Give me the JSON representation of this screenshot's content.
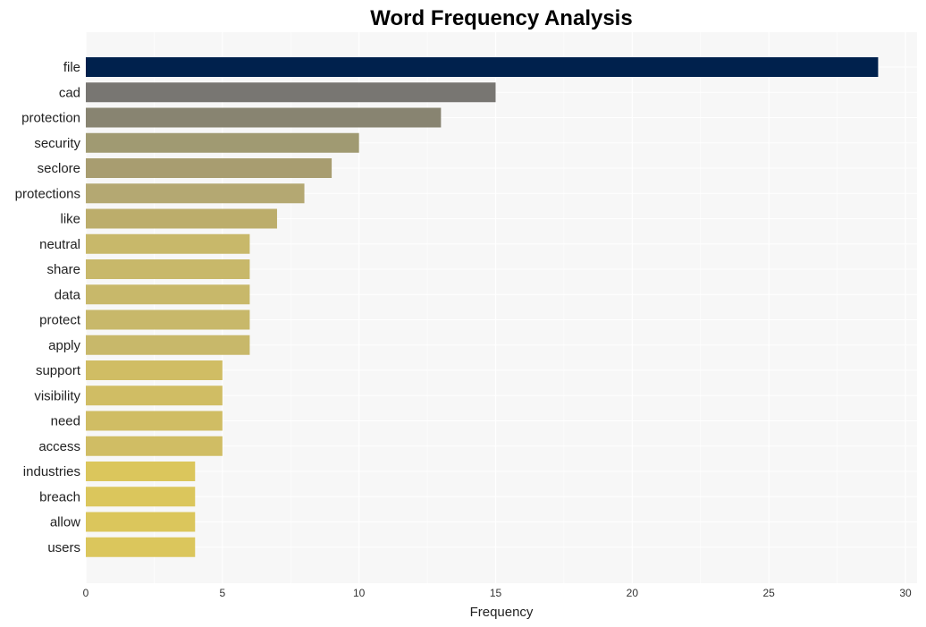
{
  "chart_data": {
    "type": "bar",
    "orientation": "horizontal",
    "title": "Word Frequency Analysis",
    "xlabel": "Frequency",
    "ylabel": "",
    "xlim": [
      0,
      30
    ],
    "xticks": [
      0,
      5,
      10,
      15,
      20,
      25,
      30
    ],
    "grid": true,
    "legend": "none",
    "categories": [
      "file",
      "cad",
      "protection",
      "security",
      "seclore",
      "protections",
      "like",
      "neutral",
      "share",
      "data",
      "protect",
      "apply",
      "support",
      "visibility",
      "need",
      "access",
      "industries",
      "breach",
      "allow",
      "users"
    ],
    "values": [
      29,
      15,
      13,
      10,
      9,
      8,
      7,
      6,
      6,
      6,
      6,
      6,
      5,
      5,
      5,
      5,
      4,
      4,
      4,
      4
    ],
    "colors": [
      "#00214d",
      "#787672",
      "#888471",
      "#a09a72",
      "#a89d70",
      "#b4a872",
      "#bcad6b",
      "#c8b86a",
      "#c8b86a",
      "#c8b86a",
      "#c8b86a",
      "#c8b86a",
      "#d0bd64",
      "#d0bd64",
      "#d0bd64",
      "#d0bd64",
      "#dbc65c",
      "#dbc65c",
      "#dbc65c",
      "#dbc65c"
    ]
  }
}
